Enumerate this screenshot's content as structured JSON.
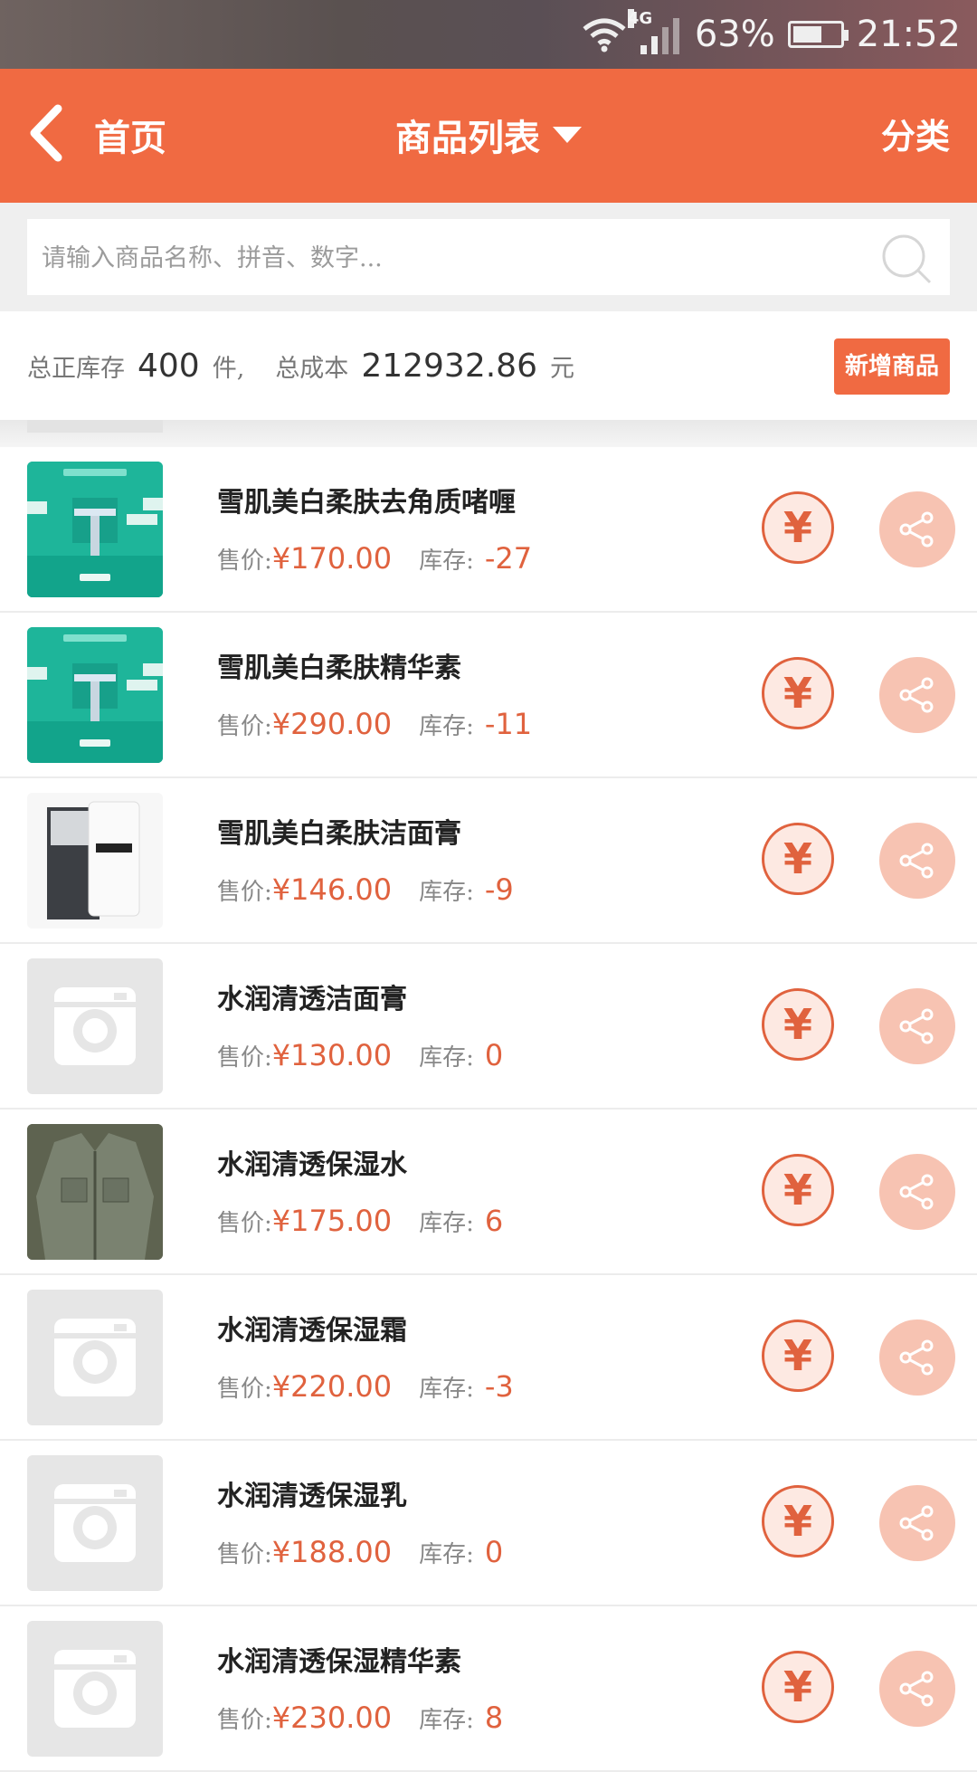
{
  "status_bar": {
    "network": "4G",
    "battery_percent": "63%",
    "battery_level": 0.63,
    "time": "21:52"
  },
  "header": {
    "back_label": "首页",
    "title": "商品列表",
    "category_label": "分类"
  },
  "search": {
    "placeholder": "请输入商品名称、拼音、数字..."
  },
  "summary": {
    "stock_label": "总正库存",
    "stock_value": "400",
    "stock_unit": "件,",
    "cost_label": "总成本",
    "cost_value": "212932.86",
    "cost_unit": "元",
    "add_button": "新增商品"
  },
  "labels": {
    "price_label": "售价:",
    "stock_label": "库存:",
    "yen_symbol": "¥"
  },
  "products": [
    {
      "name": "雪肌美白柔肤去角质啫喱",
      "price": "¥170.00",
      "stock": "-27",
      "thumb": "teal"
    },
    {
      "name": "雪肌美白柔肤精华素",
      "price": "¥290.00",
      "stock": "-11",
      "thumb": "teal"
    },
    {
      "name": "雪肌美白柔肤洁面膏",
      "price": "¥146.00",
      "stock": "-9",
      "thumb": "bottle"
    },
    {
      "name": "水润清透洁面膏",
      "price": "¥130.00",
      "stock": "0",
      "thumb": "placeholder"
    },
    {
      "name": "水润清透保湿水",
      "price": "¥175.00",
      "stock": "6",
      "thumb": "jacket"
    },
    {
      "name": "水润清透保湿霜",
      "price": "¥220.00",
      "stock": "-3",
      "thumb": "placeholder"
    },
    {
      "name": "水润清透保湿乳",
      "price": "¥188.00",
      "stock": "0",
      "thumb": "placeholder"
    },
    {
      "name": "水润清透保湿精华素",
      "price": "¥230.00",
      "stock": "8",
      "thumb": "placeholder"
    }
  ],
  "colors": {
    "accent": "#f06a42",
    "price": "#e0623e",
    "share_bg": "#f7c3b2"
  }
}
